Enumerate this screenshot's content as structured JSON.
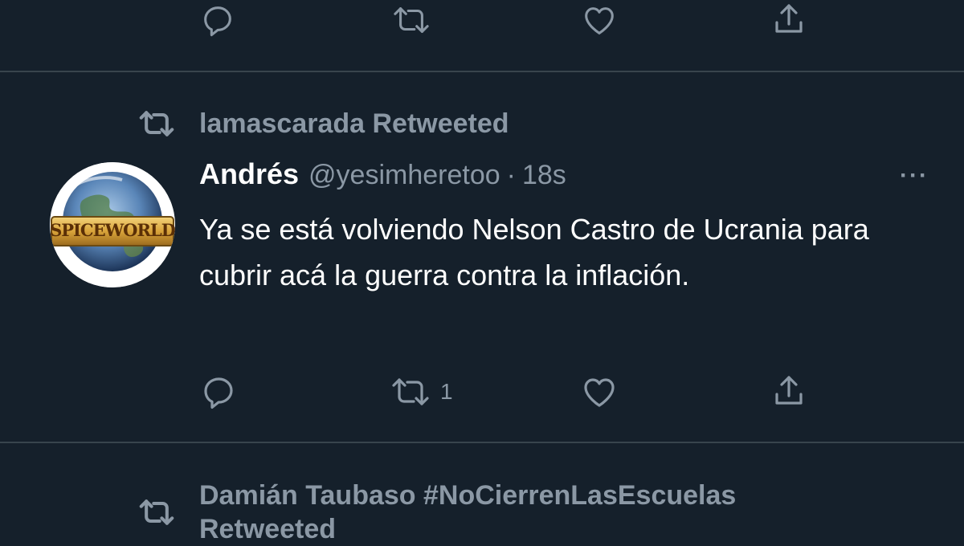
{
  "top_tweet": {
    "actions": [
      {
        "icon": "reply-icon",
        "count": ""
      },
      {
        "icon": "retweet-icon",
        "count": ""
      },
      {
        "icon": "like-icon",
        "count": ""
      },
      {
        "icon": "share-icon",
        "count": ""
      }
    ]
  },
  "tweet": {
    "retweeted_by": "lamascarada Retweeted",
    "avatar_logo_text": "SPICEWORLD",
    "author_name": "Andrés",
    "author_handle": "@yesimheretoo",
    "separator": "·",
    "time": "18s",
    "more_label": "···",
    "text": "Ya se está volviendo Nelson Castro de Ucrania para cubrir acá la guerra contra la inflación.",
    "actions": {
      "reply_count": "",
      "retweet_count": "1",
      "like_count": "",
      "share_count": ""
    }
  },
  "next_tweet": {
    "retweeted_by_line1": "Damián Taubaso #NoCierrenLasEscuelas",
    "retweeted_by_line2": "Retweeted"
  },
  "colors": {
    "background": "#15202b",
    "secondary_text": "#8b98a5",
    "divider": "#38444d"
  }
}
